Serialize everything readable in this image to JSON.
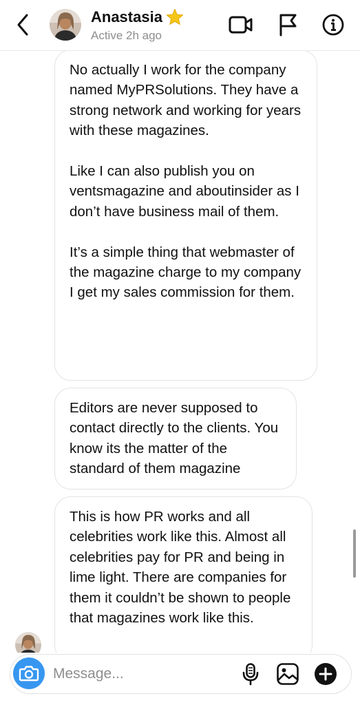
{
  "header": {
    "name": "Anastasia",
    "status": "Active 2h ago",
    "icons": {
      "back": "chevron-left-icon",
      "star": "star-icon",
      "video": "video-camera-icon",
      "flag": "flag-icon",
      "info": "info-icon"
    }
  },
  "messages": [
    {
      "paragraphs": [
        "No actually I work for the company named MyPRSolutions. They have a strong network and working for years with these magazines.",
        "Like I can also publish you on ventsmagazine and aboutinsider as I don’t have business mail of them.",
        "It’s a simple thing that webmaster of the magazine charge to my company I get my sales commission for them."
      ]
    },
    {
      "paragraphs": [
        "Editors are never supposed to contact directly to the clients. You know its the matter of the standard of them magazine"
      ]
    },
    {
      "paragraphs": [
        "This is how PR works and all celebrities work like this. Almost all celebrities pay for PR and being in lime light. There are companies for them it couldn’t be shown to people that magazines work like this."
      ]
    }
  ],
  "composer": {
    "placeholder": "Message...",
    "value": "",
    "icons": {
      "camera": "camera-icon",
      "mic": "microphone-icon",
      "gallery": "image-gallery-icon",
      "plus": "plus-icon"
    }
  },
  "colors": {
    "accent": "#3797f0",
    "secondary_text": "#8e8e8e",
    "bubble_border": "#e3e3e3",
    "star": "#f5c518"
  }
}
